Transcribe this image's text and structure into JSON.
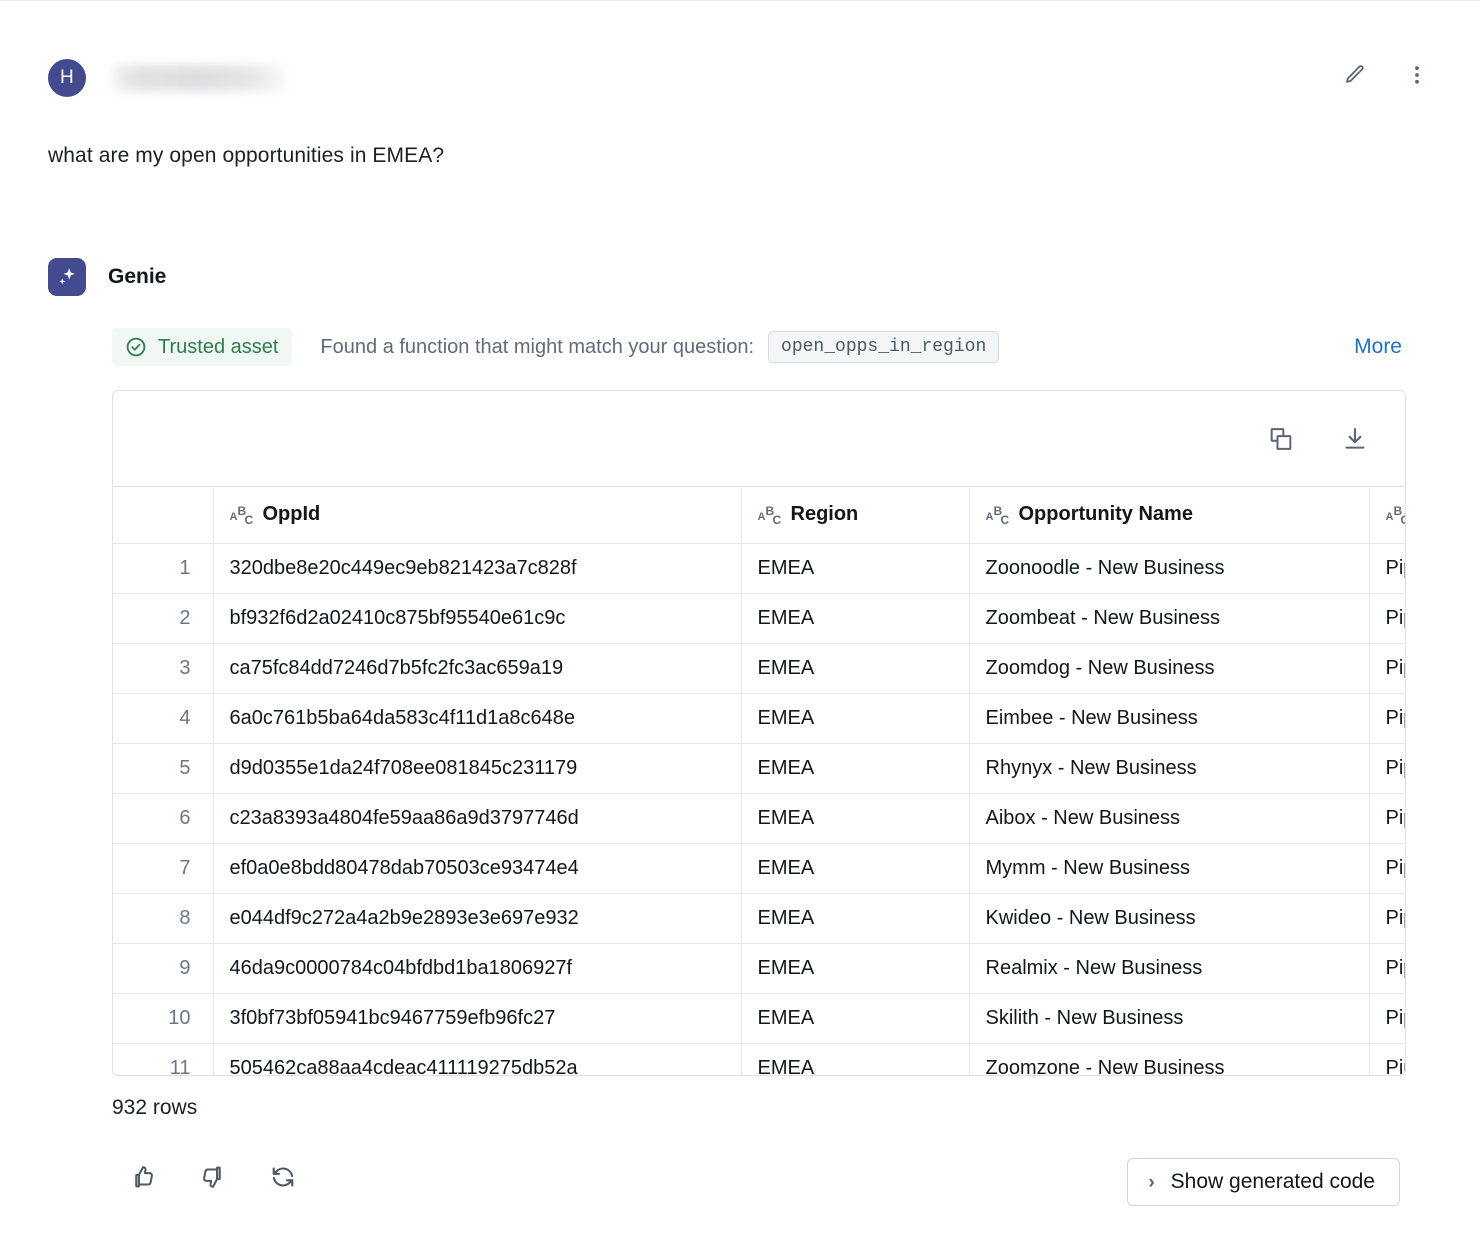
{
  "user": {
    "avatar_initial": "H",
    "name_redacted": true,
    "message": "what are my open opportunities in EMEA?",
    "edit_icon": "pencil-icon",
    "menu_icon": "more-vertical-icon"
  },
  "assistant": {
    "name": "Genie",
    "icon": "sparkle-icon",
    "trusted_badge": "Trusted asset",
    "found_text": "Found a function that might match your question:",
    "function_name": "open_opps_in_region",
    "more_label": "More"
  },
  "result_table": {
    "toolbar": {
      "copy_icon": "copy-icon",
      "download_icon": "download-icon"
    },
    "columns": [
      {
        "label": "OppId",
        "type_icon": "abc-string-icon"
      },
      {
        "label": "Region",
        "type_icon": "abc-string-icon"
      },
      {
        "label": "Opportunity Name",
        "type_icon": "abc-string-icon"
      },
      {
        "label": "",
        "type_icon": "abc-string-icon"
      }
    ],
    "rows": [
      {
        "n": "1",
        "oppid": "320dbe8e20c449ec9eb821423a7c828f",
        "region": "EMEA",
        "name": "Zoonoodle - New Business",
        "stage": "Pip"
      },
      {
        "n": "2",
        "oppid": "bf932f6d2a02410c875bf95540e61c9c",
        "region": "EMEA",
        "name": "Zoombeat - New Business",
        "stage": "Pip"
      },
      {
        "n": "3",
        "oppid": "ca75fc84dd7246d7b5fc2fc3ac659a19",
        "region": "EMEA",
        "name": "Zoomdog - New Business",
        "stage": "Pip"
      },
      {
        "n": "4",
        "oppid": "6a0c761b5ba64da583c4f11d1a8c648e",
        "region": "EMEA",
        "name": "Eimbee - New Business",
        "stage": "Pip"
      },
      {
        "n": "5",
        "oppid": "d9d0355e1da24f708ee081845c231179",
        "region": "EMEA",
        "name": "Rhynyx - New Business",
        "stage": "Pip"
      },
      {
        "n": "6",
        "oppid": "c23a8393a4804fe59aa86a9d3797746d",
        "region": "EMEA",
        "name": "Aibox - New Business",
        "stage": "Pip"
      },
      {
        "n": "7",
        "oppid": "ef0a0e8bdd80478dab70503ce93474e4",
        "region": "EMEA",
        "name": "Mymm - New Business",
        "stage": "Pip"
      },
      {
        "n": "8",
        "oppid": "e044df9c272a4a2b9e2893e3e697e932",
        "region": "EMEA",
        "name": "Kwideo - New Business",
        "stage": "Pip"
      },
      {
        "n": "9",
        "oppid": "46da9c0000784c04bfdbd1ba1806927f",
        "region": "EMEA",
        "name": "Realmix - New Business",
        "stage": "Pip"
      },
      {
        "n": "10",
        "oppid": "3f0bf73bf05941bc9467759efb96fc27",
        "region": "EMEA",
        "name": "Skilith - New Business",
        "stage": "Pip"
      },
      {
        "n": "11",
        "oppid": "505462ca88aa4cdeac411119275db52a",
        "region": "EMEA",
        "name": "Zoomzone - New Business",
        "stage": "Pip"
      }
    ]
  },
  "footer": {
    "rows_count": "932 rows",
    "thumbs_up_icon": "thumbs-up-icon",
    "thumbs_down_icon": "thumbs-down-icon",
    "retry_icon": "refresh-icon",
    "show_code_label": "Show generated code",
    "show_code_chevron": "chevron-right-icon"
  },
  "colors": {
    "avatar_bg": "#434a8f",
    "genie_bg": "#434a8f",
    "trusted_green": "#2e7d4f",
    "trusted_bg": "#f1f8f3",
    "link_blue": "#1f6fd0",
    "border": "#dde1e6"
  }
}
